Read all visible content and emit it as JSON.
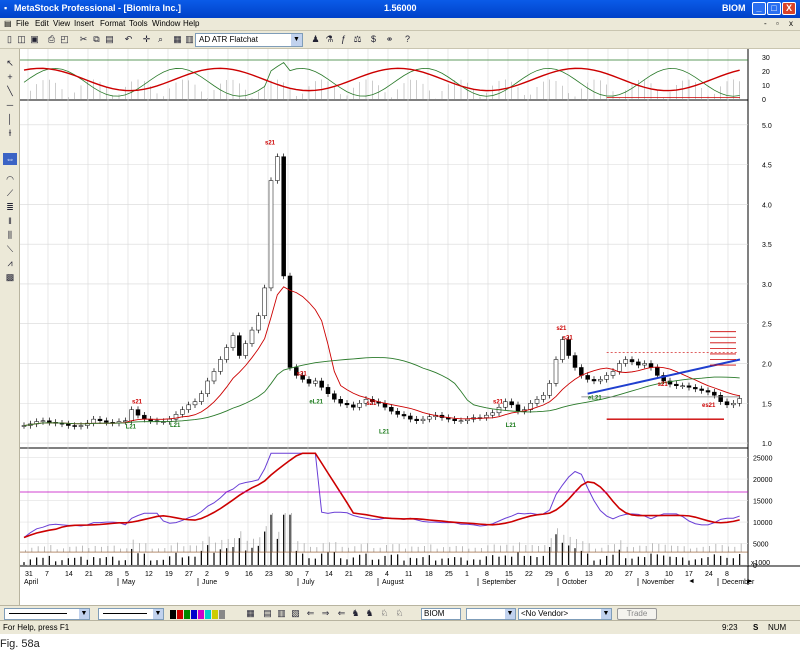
{
  "window": {
    "title": "MetaStock Professional - [Biomira Inc.]",
    "price": "1.56000",
    "symbol": "BIOM",
    "controls": [
      "_",
      "□",
      "X"
    ],
    "mdi_controls": [
      "-",
      "▫",
      "x"
    ]
  },
  "menu": [
    "File",
    "Edit",
    "View",
    "Insert",
    "Format",
    "Tools",
    "Window",
    "Help"
  ],
  "toolbar": {
    "template": "AD ATR Flatchat"
  },
  "chart": {
    "price_axis": [
      "5.0",
      "4.5",
      "4.0",
      "3.5",
      "3.0",
      "2.5",
      "2.0",
      "1.5",
      "1.0"
    ],
    "oscillator_axis": [
      "30",
      "20",
      "10",
      "0"
    ],
    "volume_axis": [
      "25000",
      "20000",
      "15000",
      "10000",
      "5000",
      "0"
    ],
    "volume_unit": "x1000",
    "date_ticks": [
      "31",
      "7",
      "14",
      "21",
      "28",
      "5",
      "12",
      "19",
      "27",
      "2",
      "9",
      "16",
      "23",
      "30",
      "7",
      "14",
      "21",
      "28",
      "4",
      "11",
      "18",
      "25",
      "1",
      "8",
      "15",
      "22",
      "29",
      "6",
      "13",
      "20",
      "27",
      "3",
      "10",
      "17",
      "24",
      "8"
    ],
    "months": [
      "April",
      "May",
      "June",
      "July",
      "August",
      "September",
      "October",
      "November",
      "December"
    ],
    "annotations": {
      "s21": "s21",
      "l21": "L21",
      "el21": "eL21",
      "s21e": "es21"
    }
  },
  "bottom": {
    "symbol_field": "BIOM",
    "vendor": "<No Vendor>",
    "trade": "Trade"
  },
  "status": {
    "help": "For Help, press F1",
    "time": "9:23",
    "s": "S",
    "num": "NUM"
  },
  "caption": "Fig. 58a",
  "colors": {
    "title_blue": "#0041c8",
    "ma_red": "#cc0000",
    "ma_green": "#2a7a2a",
    "bw_purple": "#6a3fd6",
    "trend_blue": "#1f3fcf"
  }
}
